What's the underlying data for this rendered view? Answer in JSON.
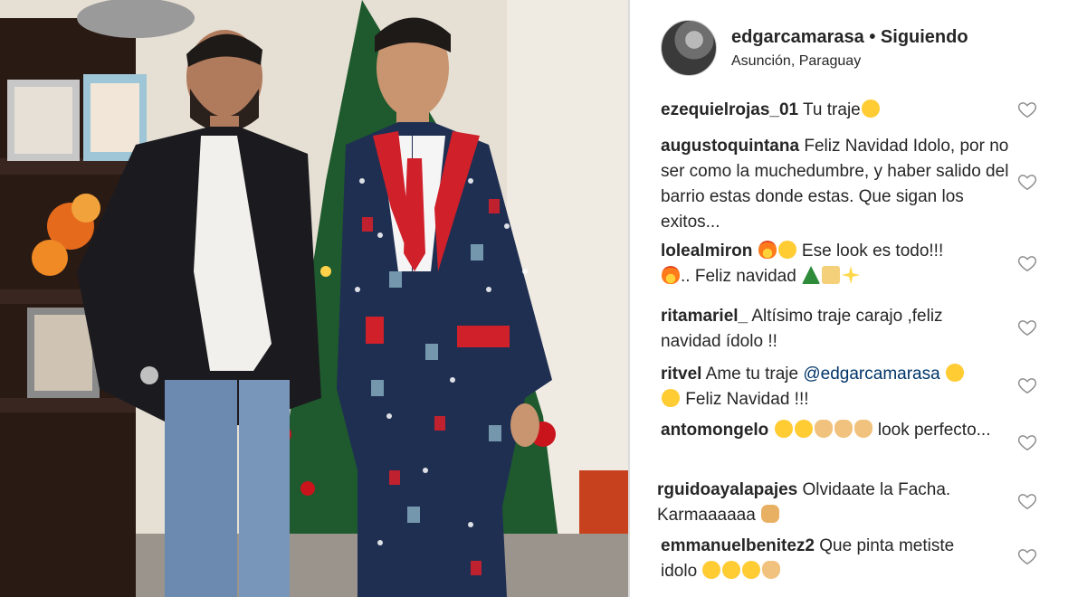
{
  "post": {
    "username": "edgarcamarasa",
    "separator": "•",
    "follow_status": "Siguiendo",
    "location": "Asunción, Paraguay"
  },
  "comments": [
    {
      "user": "ezequielrojas_01",
      "text": "Tu traje",
      "emojis": [
        "heart-eyes"
      ]
    },
    {
      "user": "augustoquintana",
      "text": "Feliz Navidad Idolo, por no ser como la muchedumbre, y haber salido del barrio estas donde estas. Que sigan los exitos..."
    },
    {
      "user": "lolealmiron",
      "text_a": "Ese look es todo!!!",
      "text_b": ".. Feliz navidad",
      "emojis": [
        "fire",
        "joy",
        "fire",
        "christmas-tree",
        "clinking-glasses",
        "sparkles"
      ]
    },
    {
      "user": "ritamariel_",
      "text": "Altísimo traje carajo ,feliz navidad ídolo !!"
    },
    {
      "user": "ritvel",
      "text_a": "Ame tu traje",
      "mention": "@edgarcamarasa",
      "text_b": "Feliz Navidad !!!",
      "emojis": [
        "heart-eyes",
        "heart-eyes"
      ]
    },
    {
      "user": "antomongelo",
      "text": "look perfecto...",
      "emojis": [
        "heart-eyes",
        "joy",
        "ok-hand",
        "ok-hand",
        "ok-hand"
      ]
    },
    {
      "user": "rguidoayalapajes",
      "text": "Olvidaate la Facha. Karmaaaaaa",
      "emojis": [
        "fist"
      ]
    },
    {
      "user": "emmanuelbenitez2",
      "text_a": "Que pinta metiste",
      "text_b": "idolo",
      "emojis": [
        "cool",
        "cool",
        "cool",
        "ok-hand"
      ]
    }
  ],
  "icons": {
    "like": "heart-outline-icon"
  },
  "colors": {
    "suit_red": "#d0202a",
    "suit_navy": "#1f2f52",
    "tree_green": "#1f5a2e",
    "text": "#262626",
    "heart_stroke": "#262626"
  }
}
